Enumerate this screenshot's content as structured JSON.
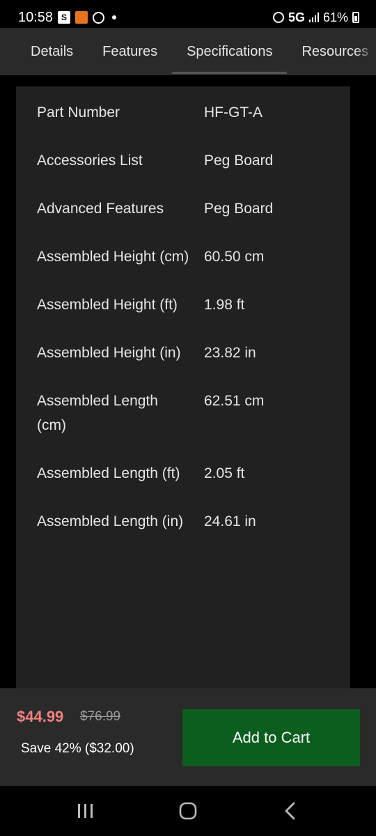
{
  "status_bar": {
    "time": "10:58",
    "network": "5G",
    "battery": "61%",
    "icons": [
      "s-app-icon",
      "shopee-icon",
      "circle-app-icon",
      "notification-dot-icon",
      "alarm-icon",
      "signal-icon",
      "battery-icon"
    ]
  },
  "tabs": [
    {
      "label": "Details"
    },
    {
      "label": "Features"
    },
    {
      "label": "Specifications"
    },
    {
      "label": "Resources"
    }
  ],
  "specs": [
    {
      "label": "Part Number",
      "value": "HF-GT-A"
    },
    {
      "label": "Accessories List",
      "value": "Peg Board"
    },
    {
      "label": "Advanced Features",
      "value": "Peg Board"
    },
    {
      "label": "Assembled Height (cm)",
      "value": "60.50 cm"
    },
    {
      "label": "Assembled Height (ft)",
      "value": "1.98 ft"
    },
    {
      "label": "Assembled Height (in)",
      "value": "23.82 in"
    },
    {
      "label": "Assembled Length (cm)",
      "value": "62.51 cm"
    },
    {
      "label": "Assembled Length (ft)",
      "value": "2.05 ft"
    },
    {
      "label": "Assembled Length (in)",
      "value": "24.61 in"
    }
  ],
  "purchase": {
    "price": "$44.99",
    "original_price": "$76.99",
    "savings": "Save 42% ($32.00)",
    "add_to_cart": "Add to Cart",
    "price_color": "#f08080",
    "button_color": "#0c5e1e"
  },
  "nav_bar": {
    "icons": [
      "recents-icon",
      "home-icon",
      "back-icon"
    ]
  }
}
